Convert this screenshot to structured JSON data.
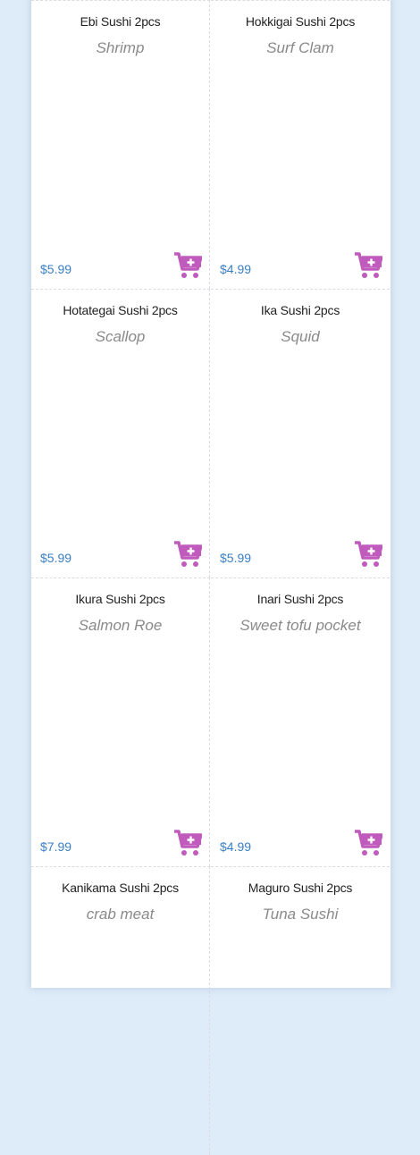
{
  "colors": {
    "accent": "#c05bbd",
    "price": "#3a7fc4",
    "background": "#deebf8"
  },
  "cart_icon": "add-to-cart-icon",
  "items": [
    {
      "name": "Ebi Sushi 2pcs",
      "desc": "Shrimp",
      "price": "$5.99"
    },
    {
      "name": "Hokkigai Sushi 2pcs",
      "desc": "Surf Clam",
      "price": "$4.99"
    },
    {
      "name": "Hotategai Sushi 2pcs",
      "desc": "Scallop",
      "price": "$5.99"
    },
    {
      "name": "Ika Sushi 2pcs",
      "desc": "Squid",
      "price": "$5.99"
    },
    {
      "name": "Ikura Sushi 2pcs",
      "desc": "Salmon Roe",
      "price": "$7.99"
    },
    {
      "name": "Inari Sushi 2pcs",
      "desc": "Sweet tofu pocket",
      "price": "$4.99"
    },
    {
      "name": "Kanikama Sushi 2pcs",
      "desc": "crab meat",
      "price": ""
    },
    {
      "name": "Maguro Sushi 2pcs",
      "desc": "Tuna Sushi",
      "price": ""
    }
  ]
}
